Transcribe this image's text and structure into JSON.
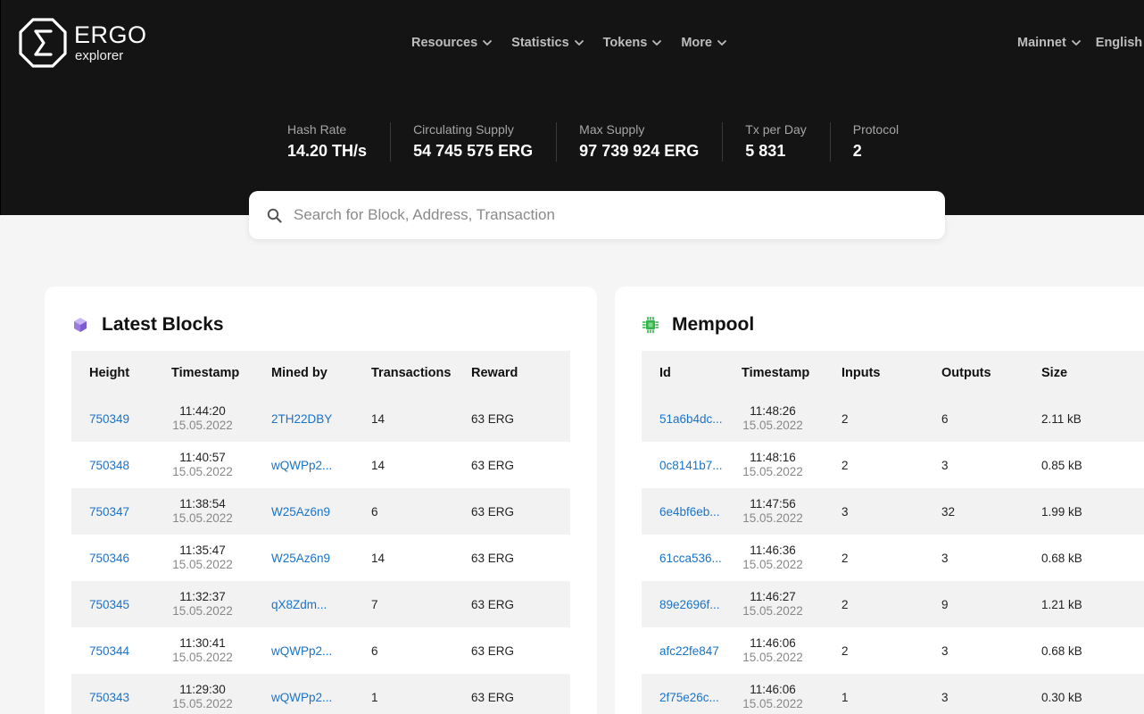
{
  "brand": {
    "name": "ERGO",
    "sub": "explorer"
  },
  "nav": {
    "items": [
      {
        "label": "Resources"
      },
      {
        "label": "Statistics"
      },
      {
        "label": "Tokens"
      },
      {
        "label": "More"
      }
    ],
    "network": "Mainnet",
    "language": "English"
  },
  "stats": [
    {
      "label": "Hash Rate",
      "value": "14.20 TH/s"
    },
    {
      "label": "Circulating Supply",
      "value": "54 745 575 ERG"
    },
    {
      "label": "Max Supply",
      "value": "97 739 924 ERG"
    },
    {
      "label": "Tx per Day",
      "value": "5 831"
    },
    {
      "label": "Protocol",
      "value": "2"
    }
  ],
  "search": {
    "placeholder": "Search for Block, Address, Transaction"
  },
  "blocks": {
    "title": "Latest Blocks",
    "columns": [
      "Height",
      "Timestamp",
      "Mined by",
      "Transactions",
      "Reward"
    ],
    "rows": [
      {
        "height": "750349",
        "time": "11:44:20",
        "date": "15.05.2022",
        "miner": "2TH22DBY",
        "tx": "14",
        "reward": "63 ERG"
      },
      {
        "height": "750348",
        "time": "11:40:57",
        "date": "15.05.2022",
        "miner": "wQWPp2...",
        "tx": "14",
        "reward": "63 ERG"
      },
      {
        "height": "750347",
        "time": "11:38:54",
        "date": "15.05.2022",
        "miner": "W25Az6n9",
        "tx": "6",
        "reward": "63 ERG"
      },
      {
        "height": "750346",
        "time": "11:35:47",
        "date": "15.05.2022",
        "miner": "W25Az6n9",
        "tx": "14",
        "reward": "63 ERG"
      },
      {
        "height": "750345",
        "time": "11:32:37",
        "date": "15.05.2022",
        "miner": "qX8Zdm...",
        "tx": "7",
        "reward": "63 ERG"
      },
      {
        "height": "750344",
        "time": "11:30:41",
        "date": "15.05.2022",
        "miner": "wQWPp2...",
        "tx": "6",
        "reward": "63 ERG"
      },
      {
        "height": "750343",
        "time": "11:29:30",
        "date": "15.05.2022",
        "miner": "wQWPp2...",
        "tx": "1",
        "reward": "63 ERG"
      }
    ]
  },
  "mempool": {
    "title": "Mempool",
    "columns": [
      "Id",
      "Timestamp",
      "Inputs",
      "Outputs",
      "Size"
    ],
    "rows": [
      {
        "id": "51a6b4dc...",
        "time": "11:48:26",
        "date": "15.05.2022",
        "inputs": "2",
        "outputs": "6",
        "size": "2.11 kB"
      },
      {
        "id": "0c8141b7...",
        "time": "11:48:16",
        "date": "15.05.2022",
        "inputs": "2",
        "outputs": "3",
        "size": "0.85 kB"
      },
      {
        "id": "6e4bf6eb...",
        "time": "11:47:56",
        "date": "15.05.2022",
        "inputs": "3",
        "outputs": "32",
        "size": "1.99 kB"
      },
      {
        "id": "61cca536...",
        "time": "11:46:36",
        "date": "15.05.2022",
        "inputs": "2",
        "outputs": "3",
        "size": "0.68 kB"
      },
      {
        "id": "89e2696f...",
        "time": "11:46:27",
        "date": "15.05.2022",
        "inputs": "2",
        "outputs": "9",
        "size": "1.21 kB"
      },
      {
        "id": "afc22fe847",
        "time": "11:46:06",
        "date": "15.05.2022",
        "inputs": "2",
        "outputs": "3",
        "size": "0.68 kB"
      },
      {
        "id": "2f75e26c...",
        "time": "11:46:06",
        "date": "15.05.2022",
        "inputs": "1",
        "outputs": "3",
        "size": "0.30 kB"
      }
    ]
  },
  "colors": {
    "header_bg": "#141414",
    "link": "#1a73c8",
    "blocks_icon": "#9b7be0",
    "mempool_icon": "#34b34a"
  },
  "icons": {
    "logo": "ergo-sigma-octagon-icon",
    "nav_chevron": "chevron-down-icon",
    "search": "search-icon",
    "blocks": "cube-icon",
    "mempool": "chip-icon"
  }
}
